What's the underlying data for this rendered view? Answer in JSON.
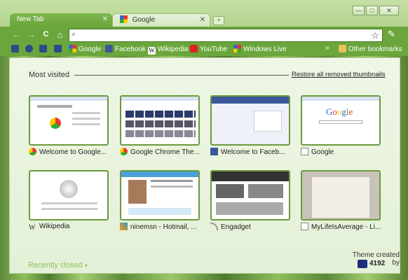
{
  "tabs": [
    {
      "label": "New Tab",
      "active": true
    },
    {
      "label": "Google",
      "active": false
    }
  ],
  "window": {
    "minimize": "—",
    "maximize": "□",
    "close": "✕"
  },
  "toolbar": {
    "back": "←",
    "forward": "→",
    "reload": "C",
    "home": "⌂",
    "omnibox_value": "",
    "star": "☆",
    "wrench": "🔧"
  },
  "bookmarks": [
    {
      "label": "",
      "icon": "bookmark-icon-1"
    },
    {
      "label": "",
      "icon": "bookmark-icon-2"
    },
    {
      "label": "",
      "icon": "bookmark-icon-3"
    },
    {
      "label": "",
      "icon": "bookmark-icon-4"
    },
    {
      "label": "Google",
      "icon": "google-icon"
    },
    {
      "label": "Facebook",
      "icon": "facebook-icon"
    },
    {
      "label": "Wikipedia",
      "icon": "wikipedia-icon"
    },
    {
      "label": "YouTube",
      "icon": "youtube-icon"
    },
    {
      "label": "Windows Live",
      "icon": "windows-icon"
    }
  ],
  "bookmarks_overflow": "»",
  "other_bookmarks": "Other bookmarks",
  "most_visited": {
    "heading": "Most visited",
    "restore": "Restore all removed thumbnails"
  },
  "thumbnails": [
    {
      "title": "Welcome to Google...",
      "icon": "chrome-icon"
    },
    {
      "title": "Google Chrome The...",
      "icon": "chrome-icon"
    },
    {
      "title": "Welcome to Faceb...",
      "icon": "facebook-icon"
    },
    {
      "title": "Google",
      "icon": "page-icon"
    },
    {
      "title": "Wikipedia",
      "icon": "wikipedia-icon"
    },
    {
      "title": "ninemsn - Hotmail, ...",
      "icon": "ninemsn-icon"
    },
    {
      "title": "Engadget",
      "icon": "rss-icon"
    },
    {
      "title": "MyLifeIsAverage - Li...",
      "icon": "page-icon"
    }
  ],
  "recently_closed": "Recently closed",
  "theme_credit": "Theme created by",
  "theme_author": "4192",
  "colors": {
    "accent": "#6aa63b",
    "page_bg": "#eef6e5",
    "thumb_border": "#6b9a3c"
  }
}
